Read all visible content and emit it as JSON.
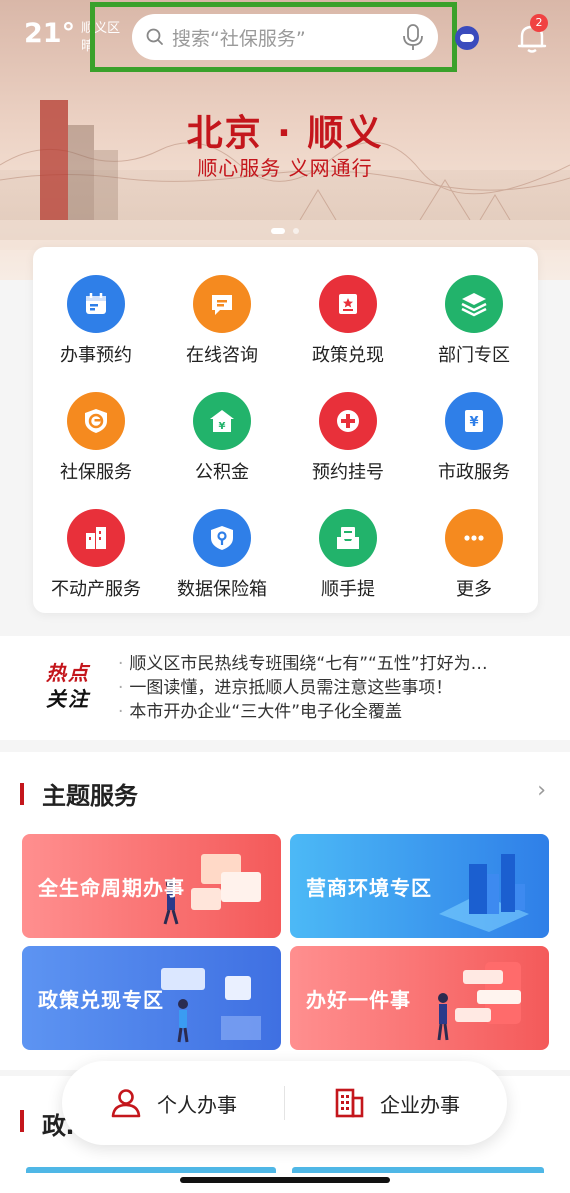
{
  "header": {
    "temperature": "21°",
    "district": "顺义区",
    "weather": "晴",
    "search_placeholder": "搜索“社保服务”",
    "notification_count": "2"
  },
  "banner": {
    "title": "北京 · 顺义",
    "subtitle": "顺心服务 义网通行"
  },
  "services": [
    {
      "label": "办事预约",
      "icon": "calendar-icon",
      "color": "#2f7fe8"
    },
    {
      "label": "在线咨询",
      "icon": "chat-icon",
      "color": "#f58a1f"
    },
    {
      "label": "政策兑现",
      "icon": "policy-icon",
      "color": "#e8303a"
    },
    {
      "label": "部门专区",
      "icon": "layers-icon",
      "color": "#22b36b"
    },
    {
      "label": "社保服务",
      "icon": "social-security-icon",
      "color": "#f58a1f"
    },
    {
      "label": "公积金",
      "icon": "house-fund-icon",
      "color": "#22b36b"
    },
    {
      "label": "预约挂号",
      "icon": "medical-cross-icon",
      "color": "#e8303a"
    },
    {
      "label": "市政服务",
      "icon": "yuan-document-icon",
      "color": "#2f7fe8"
    },
    {
      "label": "不动产服务",
      "icon": "building-icon",
      "color": "#e8303a"
    },
    {
      "label": "数据保险箱",
      "icon": "shield-key-icon",
      "color": "#2f7fe8"
    },
    {
      "label": "顺手提",
      "icon": "inbox-icon",
      "color": "#22b36b"
    },
    {
      "label": "更多",
      "icon": "more-icon",
      "color": "#f58a1f"
    }
  ],
  "hot_news": {
    "badge_line1": "热点",
    "badge_line2": "关注",
    "items": [
      "顺义区市民热线专班围绕“七有”“五性”打好为…",
      "一图读懂，进京抵顺人员需注意这些事项！",
      "本市开办企业“三大件”电子化全覆盖"
    ]
  },
  "theme_services": {
    "title": "主题服务",
    "tiles": [
      {
        "label": "全生命周期办事",
        "color_from": "#ff8a8a",
        "color_to": "#f25a5a"
      },
      {
        "label": "营商环境专区",
        "color_from": "#45b6f5",
        "color_to": "#2f7fe8"
      },
      {
        "label": "政策兑现专区",
        "color_from": "#5b8ff0",
        "color_to": "#3b6fe0"
      },
      {
        "label": "办好一件事",
        "color_from": "#ff8a8a",
        "color_to": "#f25a5a"
      }
    ]
  },
  "policy_section": {
    "title": "政…"
  },
  "bottom_nav": {
    "personal": "个人办事",
    "business": "企业办事"
  }
}
